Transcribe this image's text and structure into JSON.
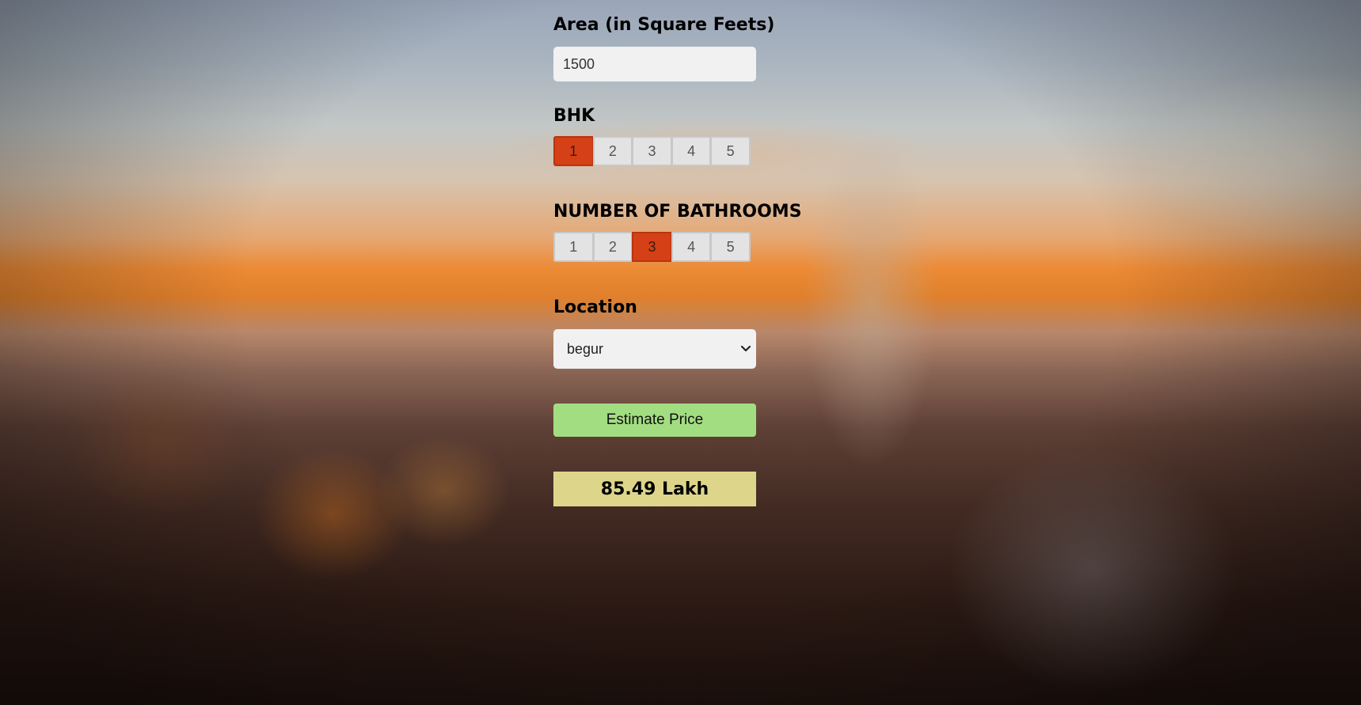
{
  "area": {
    "label": "Area (in Square Feets)",
    "value": "1500"
  },
  "bhk": {
    "label": "BHK",
    "options": [
      "1",
      "2",
      "3",
      "4",
      "5"
    ],
    "selected": "1"
  },
  "bathrooms": {
    "label": "NUMBER OF BATHROOMS",
    "options": [
      "1",
      "2",
      "3",
      "4",
      "5"
    ],
    "selected": "3"
  },
  "location": {
    "label": "Location",
    "selected": "begur",
    "icon": "chevron-down-icon"
  },
  "estimate_button": {
    "label": "Estimate Price",
    "color": "#a3dd82"
  },
  "result": {
    "text": "85.49 Lakh",
    "color": "#ddd68a"
  },
  "colors": {
    "selected_segment": "#d54016"
  }
}
